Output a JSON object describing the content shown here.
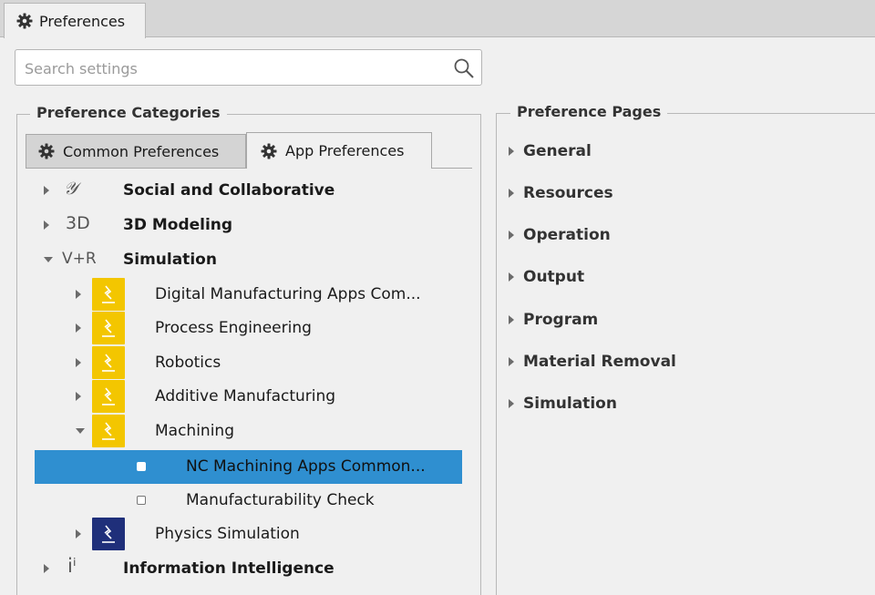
{
  "window_tab": {
    "title": "Preferences",
    "icon": "gear-icon"
  },
  "search": {
    "placeholder": "Search settings",
    "value": ""
  },
  "categories": {
    "legend": "Preference Categories",
    "tabs": [
      {
        "label": "Common Preferences",
        "icon": "gear-icon",
        "active": false
      },
      {
        "label": "App Preferences",
        "icon": "gear-icon",
        "active": true
      }
    ],
    "tree": [
      {
        "label": "Social and Collaborative",
        "level": 1,
        "expanded": false,
        "glyph": "𝒴",
        "icon": "social-collaborative-icon"
      },
      {
        "label": "3D Modeling",
        "level": 1,
        "expanded": false,
        "glyph": "3D",
        "icon": "3d-modeling-icon"
      },
      {
        "label": "Simulation",
        "level": 1,
        "expanded": true,
        "glyph": "V+R",
        "icon": "simulation-icon"
      },
      {
        "label": "Digital Manufacturing Apps Com...",
        "level": 2,
        "expanded": false,
        "icon": "app-tile-icon"
      },
      {
        "label": "Process Engineering",
        "level": 2,
        "expanded": false,
        "icon": "app-tile-icon"
      },
      {
        "label": "Robotics",
        "level": 2,
        "expanded": false,
        "icon": "app-tile-icon"
      },
      {
        "label": "Additive Manufacturing",
        "level": 2,
        "expanded": false,
        "icon": "app-tile-icon"
      },
      {
        "label": "Machining",
        "level": 2,
        "expanded": true,
        "icon": "app-tile-icon"
      },
      {
        "label": "NC Machining Apps Common...",
        "level": 3,
        "selected": true,
        "icon": "leaf-icon"
      },
      {
        "label": "Manufacturability Check",
        "level": 3,
        "selected": false,
        "icon": "leaf-icon"
      },
      {
        "label": "Physics Simulation",
        "level": 2,
        "expanded": false,
        "icon": "app-tile-dark-icon"
      },
      {
        "label": "Information Intelligence",
        "level": 1,
        "expanded": false,
        "glyph": "iⁱ",
        "icon": "information-intelligence-icon"
      }
    ]
  },
  "pages": {
    "legend": "Preference Pages",
    "items": [
      "General",
      "Resources",
      "Operation",
      "Output",
      "Program",
      "Material Removal",
      "Simulation"
    ]
  },
  "colors": {
    "selection": "#2f8fd0",
    "app_tile": "#f3c600",
    "app_tile_dark": "#1f2f7a"
  }
}
